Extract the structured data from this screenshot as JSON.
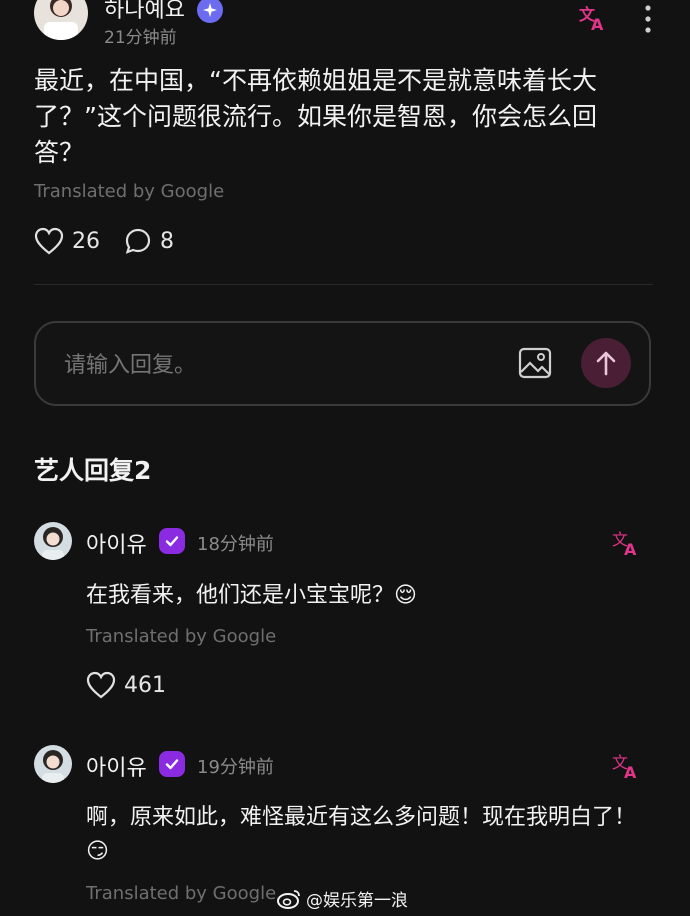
{
  "post": {
    "author": "하나예요",
    "time": "21分钟前",
    "text": "最近，在中国，“不再依赖姐姐是不是就意味着长大了？”这个问题很流行。如果你是智恩，你会怎么回答？",
    "translated": "Translated by Google",
    "likes": "26",
    "comments": "8"
  },
  "reply_box": {
    "placeholder": "请输入回复。"
  },
  "section": {
    "title": "艺人回复2"
  },
  "replies": [
    {
      "author": "아이유",
      "time": "18分钟前",
      "text": "在我看来，他们还是小宝宝呢？",
      "emoji": "😌",
      "translated": "Translated by Google",
      "likes": "461"
    },
    {
      "author": "아이유",
      "time": "19分钟前",
      "text": "啊，原来如此，难怪最近有这么多问题！现在我明白了！",
      "emoji": "😏",
      "translated": "Translated by Google"
    }
  ],
  "watermark": {
    "text": "@娱乐第一浪"
  },
  "colors": {
    "accent": "#e0358a",
    "send_button": "#4a1f36",
    "verified_blue": "#6c6cf0",
    "background": "#121212"
  },
  "icons": [
    "translate-icon",
    "more-vert-icon",
    "heart-icon",
    "comment-icon",
    "image-icon",
    "arrow-up-icon",
    "verified-badge-icon"
  ]
}
